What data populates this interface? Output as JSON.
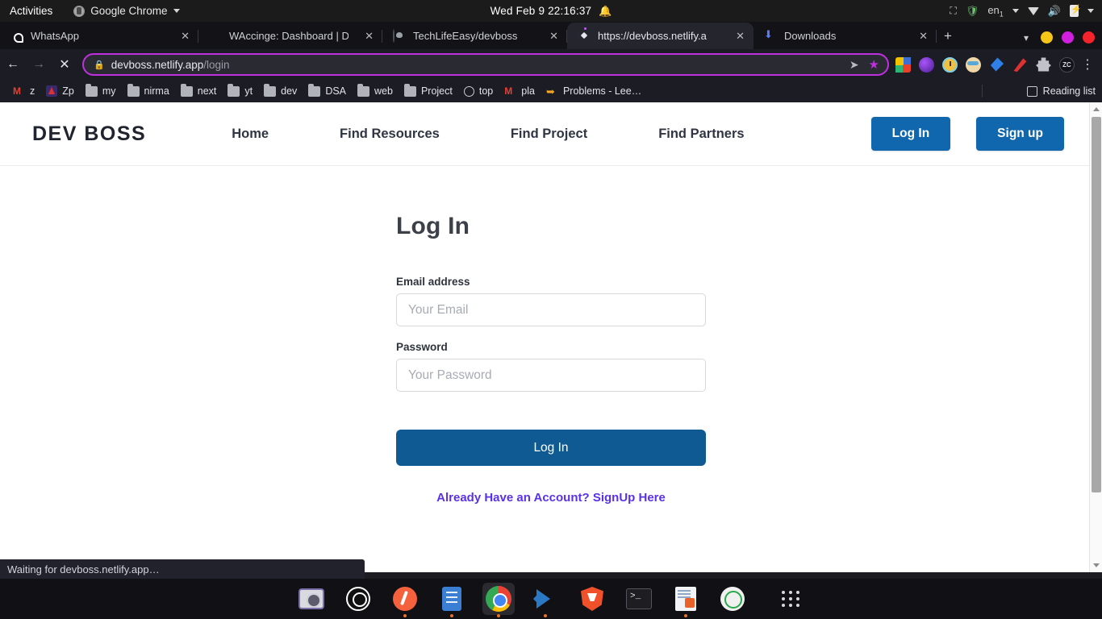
{
  "os_bar": {
    "activities": "Activities",
    "app_name": "Google Chrome",
    "clock": "Wed Feb 9  22:16:37",
    "keyboard_lang": "en",
    "keyboard_lang_sub": "1"
  },
  "browser": {
    "tabs": [
      {
        "title": "WhatsApp",
        "icon": "whatsapp-icon",
        "active": false
      },
      {
        "title": "WAccinge: Dashboard | D",
        "icon": "waccinge-icon",
        "active": false
      },
      {
        "title": "TechLifeEasy/devboss",
        "icon": "github-icon",
        "active": false
      },
      {
        "title": "https://devboss.netlify.a",
        "icon": "netlify-icon",
        "active": true
      },
      {
        "title": "Downloads",
        "icon": "download-icon",
        "active": false
      }
    ],
    "close_glyph": "✕",
    "new_tab_glyph": "+",
    "window_controls": {
      "minimize_color": "#f5c518",
      "maximize_color": "#d11fe0",
      "close_color": "#f5232b"
    },
    "nav": {
      "back": "←",
      "forward": "→",
      "stop": "✕"
    },
    "omnibox": {
      "lock_icon": "lock-icon",
      "url_host": "devboss.netlify.app",
      "url_path": "/login",
      "border_color": "#c030e0",
      "send_icon": "send-icon",
      "star_icon": "bookmark-star-icon"
    },
    "extensions": [
      "extension-colorgrid-icon",
      "extension-purple-orb-icon",
      "extension-alarm-icon",
      "extension-face-icon",
      "extension-blue-bird-icon",
      "extension-red-pen-icon",
      "extension-puzzle-icon",
      "extension-zc-icon"
    ],
    "menu_glyph": "⋮",
    "bookmarks": [
      {
        "label": "z",
        "icon": "gmail-icon"
      },
      {
        "label": "Zp",
        "icon": "zp-icon"
      },
      {
        "label": "my",
        "icon": "folder-icon"
      },
      {
        "label": "nirma",
        "icon": "folder-icon"
      },
      {
        "label": "next",
        "icon": "folder-icon"
      },
      {
        "label": "yt",
        "icon": "folder-icon"
      },
      {
        "label": "dev",
        "icon": "folder-icon"
      },
      {
        "label": "DSA",
        "icon": "folder-icon"
      },
      {
        "label": "web",
        "icon": "folder-icon"
      },
      {
        "label": "Project",
        "icon": "folder-icon"
      },
      {
        "label": "top",
        "icon": "clock-icon"
      },
      {
        "label": "pla",
        "icon": "gmail-icon"
      },
      {
        "label": "Problems - Lee…",
        "icon": "leetcode-icon"
      }
    ],
    "reading_list": "Reading list",
    "status_text": "Waiting for devboss.netlify.app…"
  },
  "site": {
    "brand": "DEV BOSS",
    "nav_links": [
      "Home",
      "Find Resources",
      "Find Project",
      "Find Partners"
    ],
    "header_buttons": {
      "login": "Log In",
      "signup": "Sign up"
    },
    "accent_color": "#1167ad",
    "form": {
      "title": "Log In",
      "email_label": "Email address",
      "email_placeholder": "Your Email",
      "email_value": "",
      "password_label": "Password",
      "password_placeholder": "Your Password",
      "password_value": "",
      "submit_label": "Log In",
      "alt_link": "Already Have an Account? SignUp Here",
      "alt_link_color": "#5a31e8",
      "submit_color": "#0f5a92"
    }
  },
  "dock": {
    "items": [
      {
        "name": "cheese-camera",
        "running": false
      },
      {
        "name": "obs-studio",
        "running": false
      },
      {
        "name": "firefox-nightly",
        "running": true
      },
      {
        "name": "files",
        "running": true
      },
      {
        "name": "google-chrome",
        "running": true,
        "active": true
      },
      {
        "name": "vs-code",
        "running": true
      },
      {
        "name": "brave-browser",
        "running": false
      },
      {
        "name": "terminal",
        "running": false
      },
      {
        "name": "document-viewer",
        "running": true
      },
      {
        "name": "timer",
        "running": false
      },
      {
        "name": "show-applications",
        "running": false
      }
    ]
  }
}
